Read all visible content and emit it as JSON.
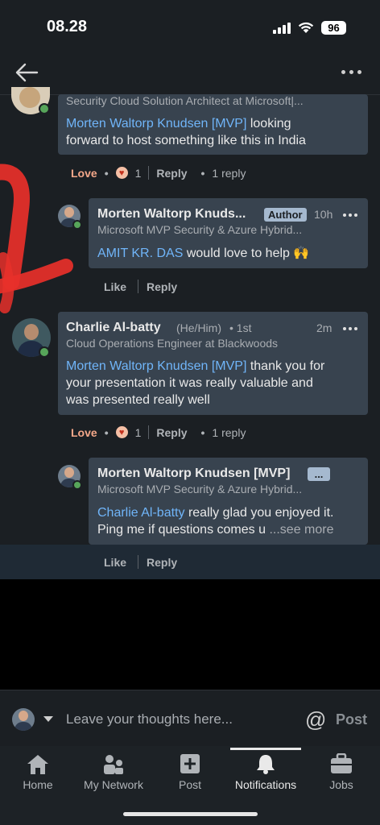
{
  "status_bar": {
    "time": "08.28",
    "battery": "96"
  },
  "comments": [
    {
      "headline": "Security Cloud Solution Architect at Microsoft|...",
      "mention": "Morten Waltorp Knudsen [MVP]",
      "text_line1": " looking",
      "text_line2": "forward to host something like this in India",
      "love_label": "Love",
      "reaction_count": "1",
      "reply_label": "Reply",
      "reply_count": "1 reply"
    },
    {
      "name": "Morten Waltorp Knuds...",
      "badge": "Author",
      "time": "10h",
      "headline": "Microsoft MVP Security & Azure Hybrid...",
      "mention": "AMIT KR. DAS",
      "text": " would love to help 🙌",
      "like_label": "Like",
      "reply_label": "Reply"
    },
    {
      "name": "Charlie Al-batty",
      "pronouns": "(He/Him)",
      "degree": "• 1st",
      "time": "2m",
      "headline": "Cloud Operations Engineer at Blackwoods",
      "mention": "Morten Waltorp Knudsen [MVP]",
      "text_line1": " thank you for",
      "text_line2": "your presentation it was really valuable and",
      "text_line3": "was presented really well",
      "love_label": "Love",
      "reaction_count": "1",
      "reply_label": "Reply",
      "reply_count": "1 reply"
    },
    {
      "name": "Morten Waltorp Knudsen [MVP]",
      "badge": "...",
      "headline": "Microsoft MVP Security & Azure Hybrid...",
      "mention": "Charlie Al-batty",
      "text_line1": " really glad you enjoyed it.",
      "text_line2": "Ping me if questions comes u",
      "see_more": "...see more",
      "like_label": "Like",
      "reply_label": "Reply"
    }
  ],
  "composer": {
    "placeholder": "Leave your thoughts here...",
    "post_label": "Post"
  },
  "tabs": [
    {
      "label": "Home",
      "icon": "home-icon"
    },
    {
      "label": "My Network",
      "icon": "network-icon"
    },
    {
      "label": "Post",
      "icon": "post-icon"
    },
    {
      "label": "Notifications",
      "icon": "bell-icon",
      "active": true
    },
    {
      "label": "Jobs",
      "icon": "briefcase-icon"
    }
  ],
  "colors": {
    "mention": "#70b5f9",
    "love": "#f5a88a",
    "background": "#1b1f23",
    "bubble": "#38434f",
    "annotation_red": "#e8302a"
  }
}
